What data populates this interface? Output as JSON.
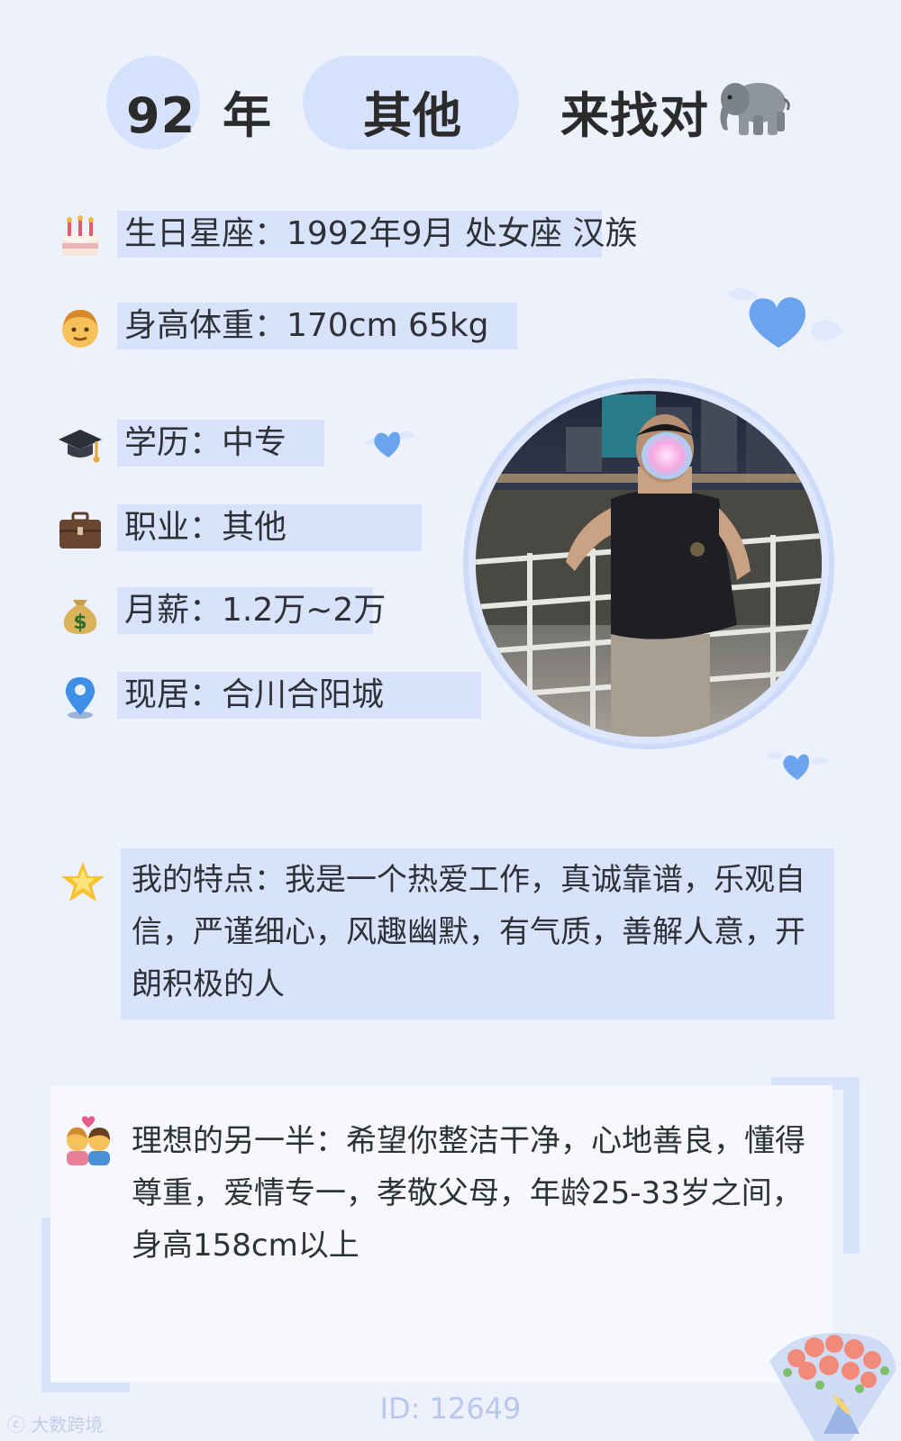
{
  "header": {
    "year": "92",
    "year_suffix": "年",
    "occupation": "其他",
    "seeking": "来找对"
  },
  "icons": {
    "elephant": "elephant-icon",
    "cake": "birthday-cake-icon",
    "person": "man-face-icon",
    "graduation": "graduation-cap-icon",
    "briefcase": "briefcase-icon",
    "money": "money-bag-icon",
    "location": "location-pin-icon",
    "star": "glowing-star-icon",
    "couple": "couple-with-heart-icon",
    "heart": "winged-heart-icon",
    "flowers": "flower-bouquet-icon"
  },
  "info": {
    "birthday": "生日星座：1992年9月 处女座 汉族",
    "height_weight": "身高体重：170cm 65kg",
    "education": "学历：中专",
    "job": "职业：其他",
    "salary": "月薪：1.2万~2万",
    "residence": "现居：合川合阳城"
  },
  "traits": {
    "text": "我的特点：我是一个热爱工作，真诚靠谱，乐观自信，严谨细心，风趣幽默，有气质，善解人意，开朗积极的人"
  },
  "ideal_partner": {
    "text": "理想的另一半：希望你整洁干净，心地善良，懂得尊重，爱情专一，孝敬父母，年龄25-33岁之间，身高158cm以上"
  },
  "footer": {
    "id": "ID: 12649",
    "watermark": "大数跨境"
  },
  "colors": {
    "background": "#edf1fc",
    "highlight": "#d8e3fb",
    "heart": "#6aa3ee",
    "id_text": "#b9c7ee"
  }
}
